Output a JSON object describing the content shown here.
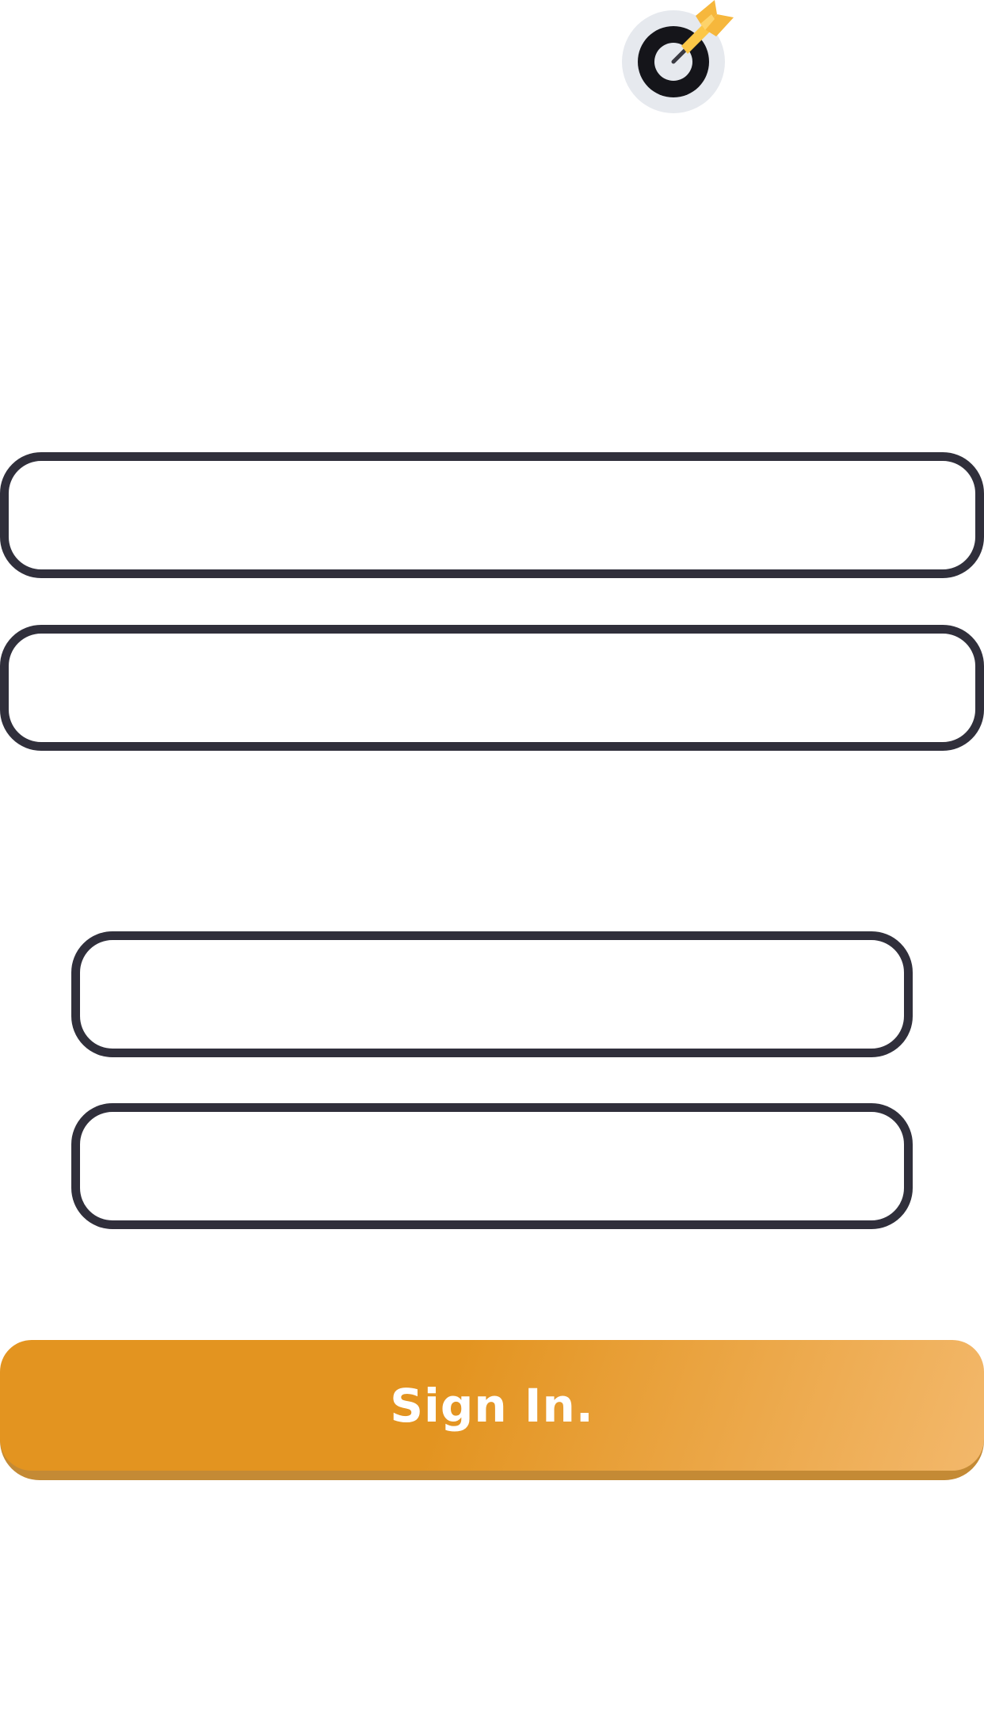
{
  "logo": {
    "icon": "target-dart-icon"
  },
  "fields": [
    {
      "value": "",
      "placeholder": ""
    },
    {
      "value": "",
      "placeholder": ""
    },
    {
      "value": "",
      "placeholder": ""
    },
    {
      "value": "",
      "placeholder": ""
    }
  ],
  "sign_in": {
    "label": "Sign In."
  },
  "colors": {
    "field_border": "#302f3b",
    "button_start": "#e39420",
    "button_end": "#f3b86b",
    "button_shadow": "#c48a35",
    "target_ring_outer": "#e6e9ee",
    "target_ring_dark": "#15151a",
    "dart": "#fcc747"
  }
}
